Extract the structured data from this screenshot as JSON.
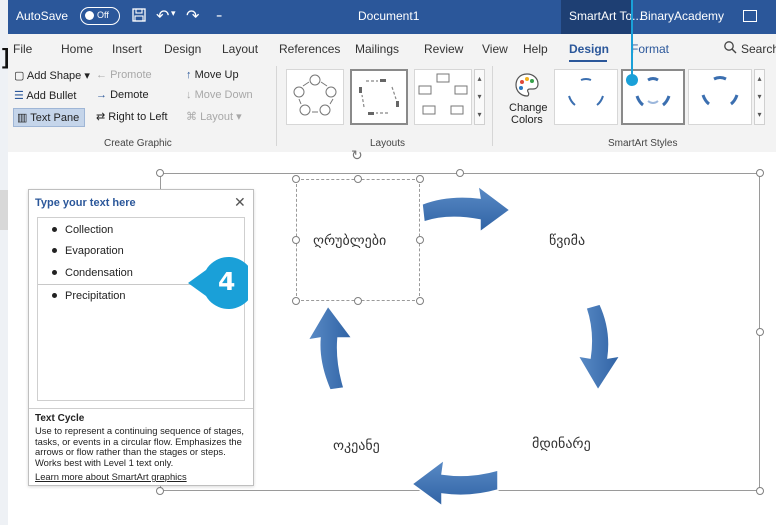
{
  "titlebar": {
    "autosave_label": "AutoSave",
    "autosave_state": "Off",
    "document_title": "Document1",
    "contextual_tab": "SmartArt To...",
    "account_name": "BinaryAcademy"
  },
  "tabs": [
    {
      "label": "File"
    },
    {
      "label": "Home"
    },
    {
      "label": "Insert"
    },
    {
      "label": "Design"
    },
    {
      "label": "Layout"
    },
    {
      "label": "References"
    },
    {
      "label": "Mailings"
    },
    {
      "label": "Review"
    },
    {
      "label": "View"
    },
    {
      "label": "Help"
    },
    {
      "label": "Design"
    },
    {
      "label": "Format"
    }
  ],
  "search_label": "Search",
  "ribbon": {
    "create_graphic": {
      "add_shape": "Add Shape",
      "add_bullet": "Add Bullet",
      "text_pane": "Text Pane",
      "promote": "Promote",
      "demote": "Demote",
      "right_to_left": "Right to Left",
      "move_up": "Move Up",
      "move_down": "Move Down",
      "layout": "Layout",
      "group_label": "Create Graphic"
    },
    "layouts": {
      "group_label": "Layouts"
    },
    "styles": {
      "change_colors_line1": "Change",
      "change_colors_line2": "Colors",
      "group_label": "SmartArt Styles"
    }
  },
  "diagram": {
    "nodes": [
      {
        "text": "ღრუბლები"
      },
      {
        "text": "წვიმა"
      },
      {
        "text": "მდინარე"
      },
      {
        "text": "ოკეანე"
      }
    ]
  },
  "text_pane": {
    "title": "Type your text here",
    "items": [
      {
        "text": "Collection"
      },
      {
        "text": "Evaporation"
      },
      {
        "text": "Condensation"
      },
      {
        "text": "Precipitation"
      }
    ],
    "info_title": "Text Cycle",
    "info_description": "Use to represent a continuing sequence of stages, tasks, or events in a circular flow. Emphasizes the arrows or flow rather than the stages or steps. Works best with Level 1 text only.",
    "learn_more": "Learn more about SmartArt graphics"
  },
  "callout": {
    "number": "4"
  },
  "colors": {
    "accent": "#2b579a",
    "arrow_fill": "#3b6fb0",
    "callout_badge": "#1aa0d8"
  }
}
